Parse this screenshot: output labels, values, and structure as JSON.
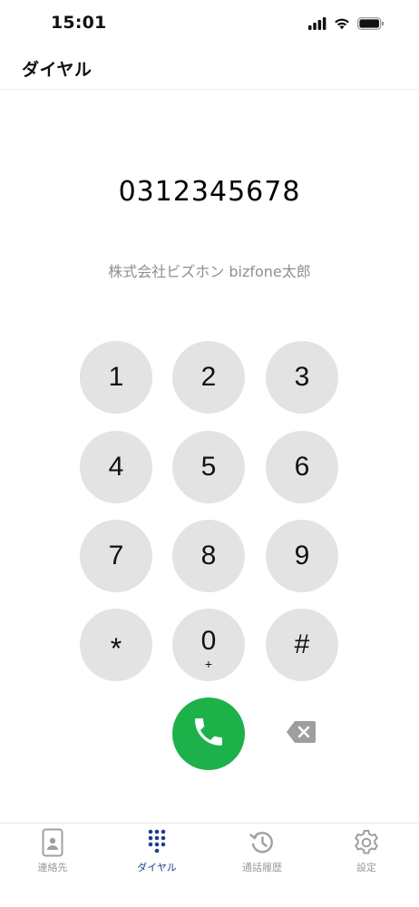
{
  "status_bar": {
    "time": "15:01",
    "icons": [
      "signal-icon",
      "wifi-icon",
      "battery-icon"
    ]
  },
  "header": {
    "title": "ダイヤル"
  },
  "dialer": {
    "number": "0312345678",
    "caller_label": "株式会社ビズホン bizfone太郎"
  },
  "keypad": {
    "keys": [
      {
        "digit": "1",
        "sub": ""
      },
      {
        "digit": "2",
        "sub": ""
      },
      {
        "digit": "3",
        "sub": ""
      },
      {
        "digit": "4",
        "sub": ""
      },
      {
        "digit": "5",
        "sub": ""
      },
      {
        "digit": "6",
        "sub": ""
      },
      {
        "digit": "7",
        "sub": ""
      },
      {
        "digit": "8",
        "sub": ""
      },
      {
        "digit": "9",
        "sub": ""
      },
      {
        "digit": "*",
        "sub": ""
      },
      {
        "digit": "0",
        "sub": "+"
      },
      {
        "digit": "#",
        "sub": ""
      }
    ]
  },
  "actions": {
    "call_icon": "phone-icon",
    "delete_icon": "backspace-icon"
  },
  "tab_bar": {
    "tabs": [
      {
        "label": "連絡先",
        "icon": "contacts-icon",
        "active": false
      },
      {
        "label": "ダイヤル",
        "icon": "dialpad-icon",
        "active": true
      },
      {
        "label": "通話履歴",
        "icon": "history-icon",
        "active": false
      },
      {
        "label": "設定",
        "icon": "gear-icon",
        "active": false
      }
    ]
  },
  "colors": {
    "call_green": "#1db14a",
    "key_gray": "#e3e3e3",
    "active_tab": "#1e3f8f",
    "inactive_tab": "#9a9a9a",
    "caller_text": "#8f8f8f"
  }
}
